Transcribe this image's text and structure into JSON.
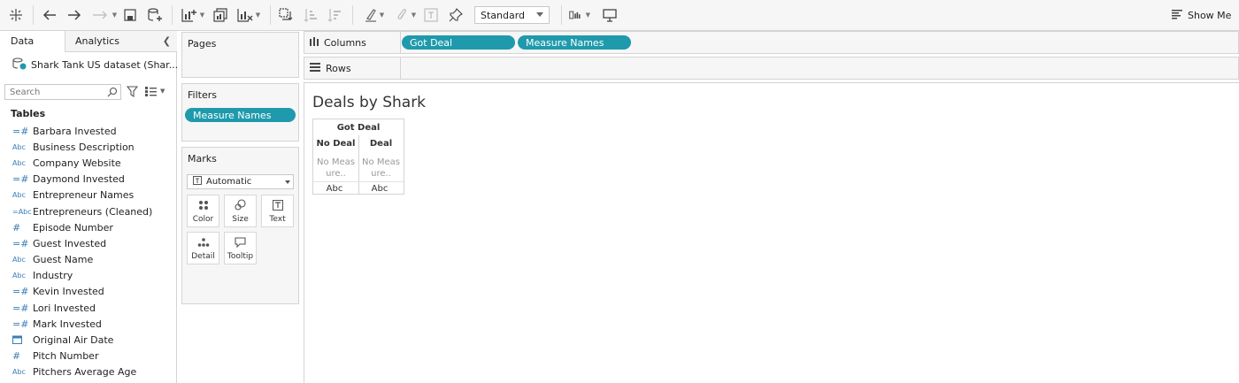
{
  "toolbar": {
    "fit_value": "Standard",
    "show_me": "Show Me"
  },
  "data_pane": {
    "tab_data": "Data",
    "tab_analytics": "Analytics",
    "datasource": "Shark Tank US dataset (Shar...",
    "search_placeholder": "Search",
    "tables_heading": "Tables",
    "fields": [
      {
        "type": "measure",
        "name": "Barbara Invested"
      },
      {
        "type": "string",
        "name": "Business Description"
      },
      {
        "type": "string",
        "name": "Company Website"
      },
      {
        "type": "measure",
        "name": "Daymond Invested"
      },
      {
        "type": "string",
        "name": "Entrepreneur Names"
      },
      {
        "type": "calc-string",
        "name": "Entrepreneurs (Cleaned)"
      },
      {
        "type": "number",
        "name": "Episode Number"
      },
      {
        "type": "measure",
        "name": "Guest Invested"
      },
      {
        "type": "string",
        "name": "Guest Name"
      },
      {
        "type": "string",
        "name": "Industry"
      },
      {
        "type": "measure",
        "name": "Kevin Invested"
      },
      {
        "type": "measure",
        "name": "Lori Invested"
      },
      {
        "type": "measure",
        "name": "Mark Invested"
      },
      {
        "type": "date",
        "name": "Original Air Date"
      },
      {
        "type": "number",
        "name": "Pitch Number"
      },
      {
        "type": "string",
        "name": "Pitchers Average Age"
      }
    ],
    "icon_glyphs": {
      "measure": "=#",
      "number": "#",
      "string": "Abc",
      "calc-string": "=Abc",
      "date": "date-icon"
    }
  },
  "pages": {
    "title": "Pages"
  },
  "filters": {
    "title": "Filters",
    "pill": "Measure Names"
  },
  "marks": {
    "title": "Marks",
    "type": "Automatic",
    "buttons": {
      "color": "Color",
      "size": "Size",
      "text": "Text",
      "detail": "Detail",
      "tooltip": "Tooltip"
    }
  },
  "shelves": {
    "columns_label": "Columns",
    "rows_label": "Rows",
    "columns_pills": [
      "Got Deal",
      "Measure Names"
    ]
  },
  "view": {
    "title": "Deals by Shark",
    "header_top": "Got Deal",
    "header_cols": [
      "No Deal",
      "Deal"
    ],
    "no_measure_text": [
      "No Meas\nure..",
      "No Meas\nure.."
    ],
    "cell_values": [
      "Abc",
      "Abc"
    ]
  },
  "colors": {
    "pill": "#1f9aac",
    "shelf_bg": "#f6f6f6",
    "border": "#d4d4d4",
    "field_icon": "#3a7db8"
  }
}
